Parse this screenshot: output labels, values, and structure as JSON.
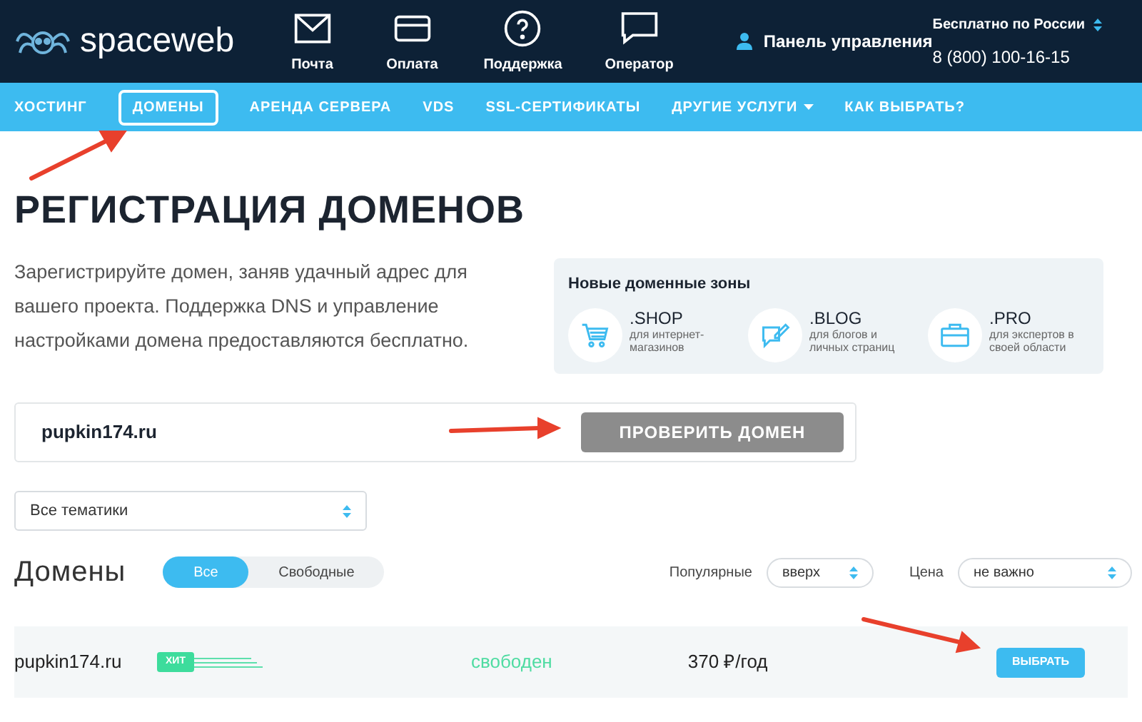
{
  "header": {
    "logo": "spaceweb",
    "icons": [
      {
        "kind": "mail",
        "label": "Почта"
      },
      {
        "kind": "card",
        "label": "Оплата"
      },
      {
        "kind": "help",
        "label": "Поддержка"
      },
      {
        "kind": "chat",
        "label": "Оператор"
      }
    ],
    "panel_link": "Панель управления",
    "phone_caption": "Бесплатно по России",
    "phone": "8 (800) 100-16-15"
  },
  "nav": [
    {
      "label": "ХОСТИНГ",
      "selected": false
    },
    {
      "label": "ДОМЕНЫ",
      "selected": true
    },
    {
      "label": "АРЕНДА СЕРВЕРА",
      "selected": false
    },
    {
      "label": "VDS",
      "selected": false
    },
    {
      "label": "SSL-СЕРТИФИКАТЫ",
      "selected": false
    },
    {
      "label": "ДРУГИЕ УСЛУГИ",
      "selected": false,
      "dropdown": true
    },
    {
      "label": "КАК ВЫБРАТЬ?",
      "selected": false
    }
  ],
  "title": "РЕГИСТРАЦИЯ ДОМЕНОВ",
  "intro": "Зарегистрируйте домен, заняв удачный адрес для вашего проекта. Поддержка DNS и управление настройками домена предоставляются бесплатно.",
  "zones": {
    "title": "Новые доменные зоны",
    "items": [
      {
        "kind": "cart",
        "name": ".SHOP",
        "desc": "для интернет-магазинов"
      },
      {
        "kind": "blog",
        "name": ".BLOG",
        "desc": "для блогов и личных страниц"
      },
      {
        "kind": "case",
        "name": ".PRO",
        "desc": "для экспертов в своей области"
      }
    ]
  },
  "search": {
    "value": "pupkin174.ru",
    "button": "ПРОВЕРИТЬ ДОМЕН"
  },
  "topic_select": "Все тематики",
  "domains": {
    "title": "Домены",
    "filters": [
      {
        "label": "Все",
        "selected": true
      },
      {
        "label": "Свободные",
        "selected": false
      }
    ],
    "sorts": [
      {
        "label": "Популярные",
        "value": "вверх"
      },
      {
        "label": "Цена",
        "value": "не важно"
      }
    ],
    "rows": [
      {
        "name": "pupkin174.ru",
        "badge": "ХИТ",
        "status": "свободен",
        "price": "370 ₽/год",
        "button": "ВЫБРАТЬ"
      }
    ]
  }
}
